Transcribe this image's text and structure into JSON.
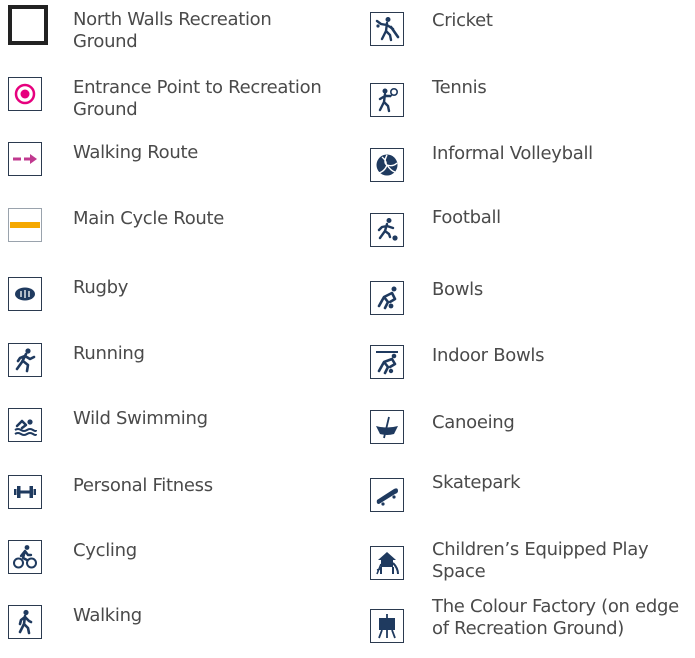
{
  "legend": {
    "left": [
      {
        "label": "North Walls Recreation\nGround",
        "icon": "boundary-square-icon"
      },
      {
        "label": "Entrance Point to Recreation\nGround",
        "icon": "entrance-target-icon"
      },
      {
        "label": "Walking Route",
        "icon": "walking-route-arrow-icon"
      },
      {
        "label": "Main Cycle Route",
        "icon": "cycle-route-line-icon"
      },
      {
        "label": "Rugby",
        "icon": "rugby-ball-icon"
      },
      {
        "label": "Running",
        "icon": "runner-icon"
      },
      {
        "label": "Wild Swimming",
        "icon": "swimmer-icon"
      },
      {
        "label": "Personal Fitness",
        "icon": "dumbbell-icon"
      },
      {
        "label": "Cycling",
        "icon": "cyclist-icon"
      },
      {
        "label": "Walking",
        "icon": "walker-icon"
      }
    ],
    "right": [
      {
        "label": "Cricket",
        "icon": "cricket-icon"
      },
      {
        "label": "Tennis",
        "icon": "tennis-icon"
      },
      {
        "label": "Informal Volleyball",
        "icon": "volleyball-icon"
      },
      {
        "label": "Football",
        "icon": "football-icon"
      },
      {
        "label": "Bowls",
        "icon": "bowls-icon"
      },
      {
        "label": "Indoor Bowls",
        "icon": "indoor-bowls-icon"
      },
      {
        "label": "Canoeing",
        "icon": "canoe-icon"
      },
      {
        "label": "Skatepark",
        "icon": "skateboard-icon"
      },
      {
        "label": "Children’s Equipped Play\nSpace",
        "icon": "play-space-icon"
      },
      {
        "label": "The Colour Factory (on edge\nof Recreation Ground)",
        "icon": "easel-icon"
      }
    ]
  },
  "colors": {
    "icon_navy": "#1f3a5f",
    "entrance_pink": "#e6007e",
    "walking_route_magenta": "#c0398f",
    "cycle_route_orange": "#f5a800",
    "text_grey": "#4a4a4a"
  }
}
